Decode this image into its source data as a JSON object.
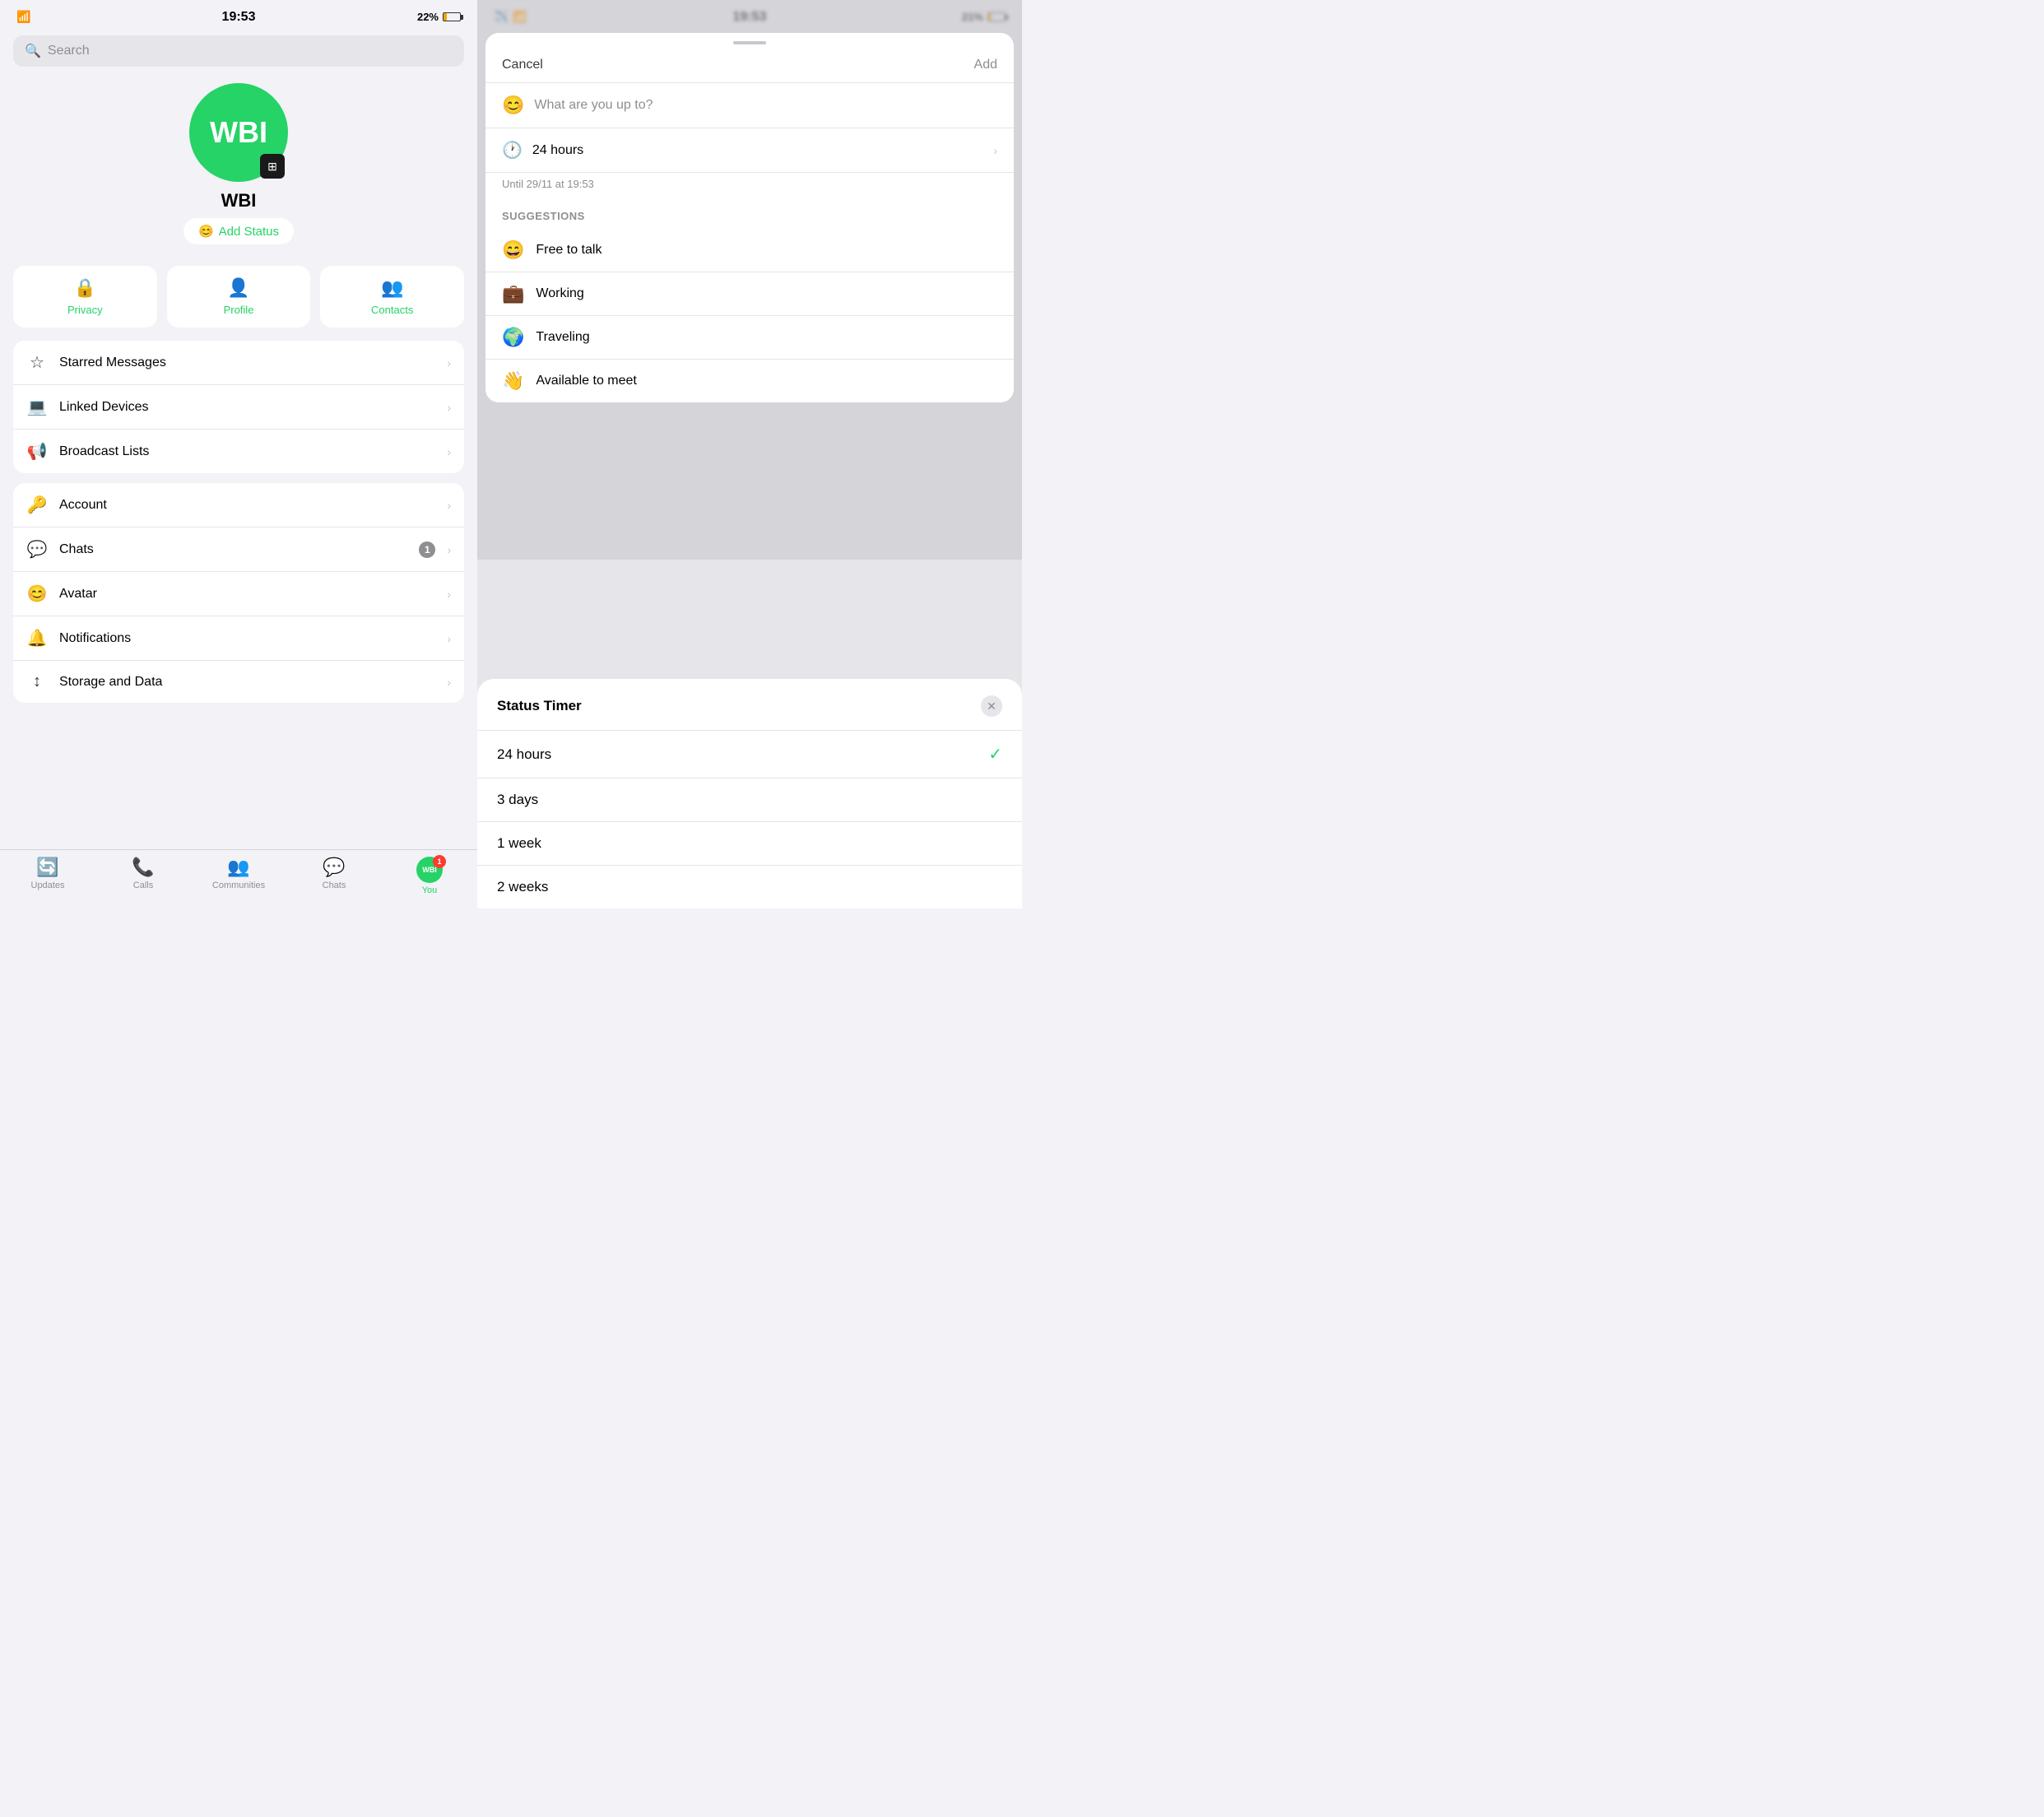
{
  "left": {
    "statusBar": {
      "time": "19:53",
      "battery": "22%"
    },
    "search": {
      "placeholder": "Search"
    },
    "profile": {
      "initials": "WBI",
      "name": "WBI",
      "addStatusLabel": "Add Status"
    },
    "quickActions": [
      {
        "icon": "🔒",
        "label": "Privacy"
      },
      {
        "icon": "👤",
        "label": "Profile"
      },
      {
        "icon": "👥",
        "label": "Contacts"
      }
    ],
    "menuGroup1": [
      {
        "icon": "☆",
        "label": "Starred Messages",
        "badge": null
      },
      {
        "icon": "💻",
        "label": "Linked Devices",
        "badge": null
      },
      {
        "icon": "📢",
        "label": "Broadcast Lists",
        "badge": null
      }
    ],
    "menuGroup2": [
      {
        "icon": "🔑",
        "label": "Account",
        "badge": null
      },
      {
        "icon": "💬",
        "label": "Chats",
        "badge": "1"
      },
      {
        "icon": "😊",
        "label": "Avatar",
        "badge": null
      },
      {
        "icon": "🔔",
        "label": "Notifications",
        "badge": null
      },
      {
        "icon": "↕",
        "label": "Storage and Data",
        "badge": null
      }
    ],
    "tabBar": [
      {
        "icon": "🔄",
        "label": "Updates",
        "active": false
      },
      {
        "icon": "📞",
        "label": "Calls",
        "active": false
      },
      {
        "icon": "👥",
        "label": "Communities",
        "active": false
      },
      {
        "icon": "💬",
        "label": "Chats",
        "active": false
      },
      {
        "label": "You",
        "active": true,
        "initials": "WBI",
        "badge": "1"
      }
    ]
  },
  "right": {
    "statusBar": {
      "time": "19:53",
      "battery": "21%"
    },
    "addStatusSheet": {
      "cancelLabel": "Cancel",
      "addLabel": "Add",
      "inputPlaceholder": "What are you up to?",
      "timerLabel": "24 hours",
      "timerSubtitle": "Until 29/11 at 19:53",
      "suggestionsHeader": "SUGGESTIONS",
      "suggestions": [
        {
          "emoji": "😄",
          "label": "Free to talk"
        },
        {
          "emoji": "💼",
          "label": "Working"
        },
        {
          "emoji": "🌍",
          "label": "Traveling"
        },
        {
          "emoji": "👋",
          "label": "Available to meet"
        }
      ]
    },
    "statusTimerSheet": {
      "title": "Status Timer",
      "options": [
        {
          "label": "24 hours",
          "selected": true
        },
        {
          "label": "3 days",
          "selected": false
        },
        {
          "label": "1 week",
          "selected": false
        },
        {
          "label": "2 weeks",
          "selected": false
        }
      ]
    }
  }
}
